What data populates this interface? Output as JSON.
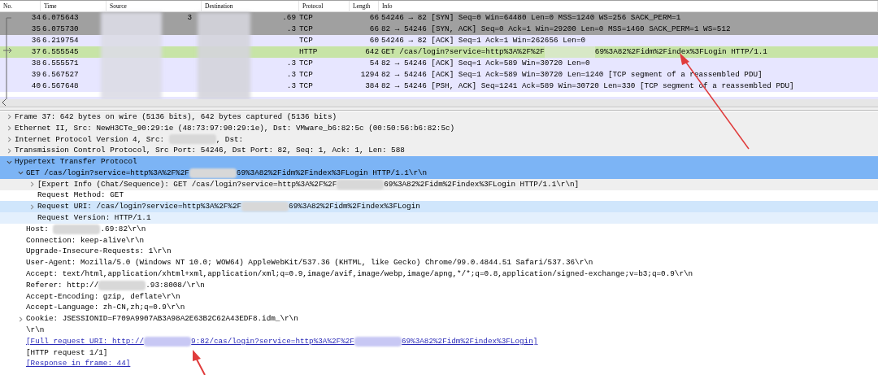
{
  "packet_list": {
    "columns": [
      "No.",
      "Time",
      "Source",
      "Destination",
      "Protocol",
      "Length",
      "Info"
    ],
    "rows": [
      {
        "no": "34",
        "time": "6.075643",
        "source": "3",
        "destination": ".69",
        "protocol": "TCP",
        "length": "66",
        "info": "54246 → 82 [SYN] Seq=0 Win=64480 Len=0 MSS=1240 WS=256 SACK_PERM=1",
        "kind": "syn"
      },
      {
        "no": "35",
        "time": "6.075730",
        "destination": ".3",
        "protocol": "TCP",
        "length": "66",
        "info": "82 → 54246 [SYN, ACK] Seq=0 Ack=1 Win=29200 Len=0 MSS=1460 SACK_PERM=1 WS=512",
        "kind": "syn"
      },
      {
        "no": "36",
        "time": "6.219754",
        "protocol": "TCP",
        "length": "60",
        "info": "54246 → 82 [ACK] Seq=1 Ack=1 Win=262656 Len=0",
        "kind": "tcp"
      },
      {
        "no": "37",
        "time": "6.555545",
        "protocol": "HTTP",
        "length": "642",
        "info": "GET /cas/login?service=http%3A%2F%2F",
        "info_after": "69%3A82%2Fidm%2Findex%3FLogin HTTP/1.1",
        "kind": "http"
      },
      {
        "no": "38",
        "time": "6.555571",
        "destination": ".3",
        "protocol": "TCP",
        "length": "54",
        "info": "82 → 54246 [ACK] Seq=1 Ack=589 Win=30720 Len=0",
        "kind": "tcp"
      },
      {
        "no": "39",
        "time": "6.567527",
        "destination": ".3",
        "protocol": "TCP",
        "length": "1294",
        "info": "82 → 54246 [ACK] Seq=1 Ack=589 Win=30720 Len=1240 [TCP segment of a reassembled PDU]",
        "kind": "tcp"
      },
      {
        "no": "40",
        "time": "6.567648",
        "destination": ".3",
        "protocol": "TCP",
        "length": "384",
        "info": "82 → 54246 [PSH, ACK] Seq=1241 Ack=589 Win=30720 Len=330 [TCP segment of a reassembled PDU]",
        "kind": "tcp"
      }
    ]
  },
  "details": [
    {
      "parts": [
        "Frame 37: 642 bytes on wire (5136 bits), 642 bytes captured (5136 bits)"
      ],
      "expanded": false,
      "color": "#efefef"
    },
    {
      "parts": [
        "Ethernet II, Src: NewH3CTe_90:29:1e (48:73:97:90:29:1e), Dst: VMware_b6:82:5c (00:50:56:b6:82:5c)"
      ],
      "expanded": false,
      "color": "#efefef"
    },
    {
      "parts": [
        "Internet Protocol Version 4, Src: ",
        ", Dst:"
      ],
      "expanded": false,
      "color": "#efefef"
    },
    {
      "parts": [
        "Transmission Control Protocol, Src Port: 54246, Dst Port: 82, Seq: 1, Ack: 1, Len: 588"
      ],
      "expanded": false,
      "color": "#efefef"
    },
    {
      "parts": [
        "Hypertext Transfer Protocol"
      ],
      "expanded": true,
      "color": "#7cb4f5",
      "children": [
        {
          "parts": [
            "GET /cas/login?service=http%3A%2F%2F",
            "69%3A82%2Fidm%2Findex%3FLogin HTTP/1.1\\r\\n"
          ],
          "expanded": true,
          "color": "#7cb4f5",
          "children": [
            {
              "parts": [
                "[Expert Info (Chat/Sequence): GET /cas/login?service=http%3A%2F%2F",
                "69%3A82%2Fidm%2Findex%3FLogin HTTP/1.1\\r\\n]"
              ],
              "expanded": false,
              "color": "#efefef"
            },
            {
              "parts": [
                "Request Method: GET"
              ]
            },
            {
              "parts": [
                "Request URI: /cas/login?service=http%3A%2F%2F",
                "69%3A82%2Fidm%2Findex%3FLogin"
              ],
              "expanded": false,
              "color": "#d0e6fc"
            },
            {
              "parts": [
                "Request Version: HTTP/1.1"
              ],
              "color": "#e4f0fd"
            }
          ]
        },
        {
          "parts": [
            "Host: ",
            ".69:82\\r\\n"
          ]
        },
        {
          "parts": [
            "Connection: keep-alive\\r\\n"
          ]
        },
        {
          "parts": [
            "Upgrade-Insecure-Requests: 1\\r\\n"
          ]
        },
        {
          "parts": [
            "User-Agent: Mozilla/5.0 (Windows NT 10.0; WOW64) AppleWebKit/537.36 (KHTML, like Gecko) Chrome/99.0.4844.51 Safari/537.36\\r\\n"
          ]
        },
        {
          "parts": [
            "Accept: text/html,application/xhtml+xml,application/xml;q=0.9,image/avif,image/webp,image/apng,*/*;q=0.8,application/signed-exchange;v=b3;q=0.9\\r\\n"
          ]
        },
        {
          "parts": [
            "Referer: http://",
            ".93:8008/\\r\\n"
          ]
        },
        {
          "parts": [
            "Accept-Encoding: gzip, deflate\\r\\n"
          ]
        },
        {
          "parts": [
            "Accept-Language: zh-CN,zh;q=0.9\\r\\n"
          ]
        },
        {
          "parts": [
            "Cookie: JSESSIONID=F709A9907AB3A98A2E63B2C62A43EDF8.idm_\\r\\n"
          ],
          "expanded": false
        },
        {
          "parts": [
            "\\r\\n"
          ]
        },
        {
          "parts": [
            "[Full request URI: http://",
            "9:82/cas/login?service=http%3A%2F%2F",
            "69%3A82%2Fidm%2Findex%3FLogin]"
          ],
          "kind": "link"
        },
        {
          "parts": [
            "[HTTP request 1/1]"
          ]
        },
        {
          "parts": [
            "[Response in frame: 44]"
          ],
          "kind": "link"
        }
      ]
    }
  ]
}
